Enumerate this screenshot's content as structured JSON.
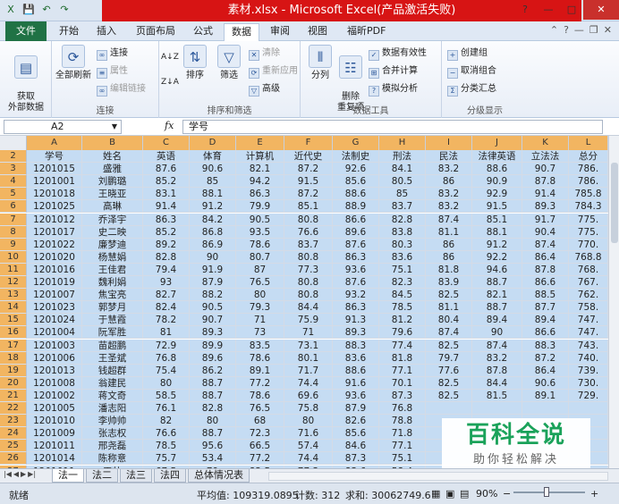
{
  "window": {
    "title": "素材.xlsx - Microsoft Excel(产品激活失败)",
    "help": "?",
    "minimize": "—",
    "maximize": "□",
    "close": "✕"
  },
  "qat": [
    "X",
    "💾",
    "↶",
    "↷"
  ],
  "tabs": {
    "file": "文件",
    "items": [
      "开始",
      "插入",
      "页面布局",
      "公式",
      "数据",
      "审阅",
      "视图",
      "福昕PDF"
    ],
    "active": "数据"
  },
  "ribbon": {
    "get_external": "获取\n外部数据",
    "refresh_all": "全部刷新",
    "connections": "连接",
    "properties": "属性",
    "edit_links": "编辑链接",
    "group_connections": "连接",
    "sort_az": "A↓Z",
    "sort_za": "Z↓A",
    "sort": "排序",
    "filter": "筛选",
    "clear": "清除",
    "reapply": "重新应用",
    "advanced": "高级",
    "group_sort": "排序和筛选",
    "split": "分列",
    "remove_dup": "删除\n重复项",
    "data_valid": "数据有效性",
    "consolidate": "合并计算",
    "whatif": "模拟分析",
    "group_datatools": "数据工具",
    "group_outline": "创建组",
    "ungroup": "取消组合",
    "subtotal": "分类汇总",
    "group_display": "分级显示"
  },
  "formula_bar": {
    "name_box": "A2",
    "fx": "fx",
    "content": "学号"
  },
  "columns": [
    "A",
    "B",
    "C",
    "D",
    "E",
    "F",
    "G",
    "H",
    "I",
    "J",
    "K",
    "L"
  ],
  "rows": [
    {
      "n": "2",
      "cells": [
        "学号",
        "姓名",
        "英语",
        "体育",
        "计算机",
        "近代史",
        "法制史",
        "刑法",
        "民法",
        "法律英语",
        "立法法",
        "总分"
      ]
    },
    {
      "n": "3",
      "cells": [
        "1201015",
        "盛雅",
        "87.6",
        "90.6",
        "82.1",
        "87.2",
        "92.6",
        "84.1",
        "83.2",
        "88.6",
        "90.7",
        "786."
      ]
    },
    {
      "n": "4",
      "cells": [
        "1201001",
        "刘鹏璐",
        "85.2",
        "85",
        "94.2",
        "91.5",
        "85.6",
        "80.5",
        "86",
        "90.9",
        "87.8",
        "786."
      ]
    },
    {
      "n": "5",
      "cells": [
        "1201018",
        "王晓亚",
        "83.1",
        "88.1",
        "86.3",
        "87.2",
        "88.6",
        "85",
        "83.2",
        "92.9",
        "91.4",
        "785.8"
      ]
    },
    {
      "n": "6",
      "cells": [
        "1201025",
        "高琳",
        "91.4",
        "91.2",
        "79.9",
        "85.1",
        "88.9",
        "83.7",
        "83.2",
        "91.5",
        "89.3",
        "784.3"
      ]
    },
    {
      "n": "7",
      "cells": [
        "1201012",
        "乔泽宇",
        "86.3",
        "84.2",
        "90.5",
        "80.8",
        "86.6",
        "82.8",
        "87.4",
        "85.1",
        "91.7",
        "775."
      ]
    },
    {
      "n": "8",
      "cells": [
        "1201017",
        "史二映",
        "85.2",
        "86.8",
        "93.5",
        "76.6",
        "89.6",
        "83.8",
        "81.1",
        "88.1",
        "90.4",
        "775."
      ]
    },
    {
      "n": "9",
      "cells": [
        "1201022",
        "廉梦迪",
        "89.2",
        "86.9",
        "78.6",
        "83.7",
        "87.6",
        "80.3",
        "86",
        "91.2",
        "87.4",
        "770."
      ]
    },
    {
      "n": "10",
      "cells": [
        "1201020",
        "杨慧娟",
        "82.8",
        "90",
        "80.7",
        "80.8",
        "86.3",
        "83.6",
        "86",
        "92.2",
        "86.4",
        "768.8"
      ]
    },
    {
      "n": "11",
      "cells": [
        "1201016",
        "王佳君",
        "79.4",
        "91.9",
        "87",
        "77.3",
        "93.6",
        "75.1",
        "81.8",
        "94.6",
        "87.8",
        "768."
      ]
    },
    {
      "n": "12",
      "cells": [
        "1201019",
        "魏利娟",
        "93",
        "87.9",
        "76.5",
        "80.8",
        "87.6",
        "82.3",
        "83.9",
        "88.7",
        "86.6",
        "767."
      ]
    },
    {
      "n": "13",
      "cells": [
        "1201007",
        "焦宝亮",
        "82.7",
        "88.2",
        "80",
        "80.8",
        "93.2",
        "84.5",
        "82.5",
        "82.1",
        "88.5",
        "762."
      ]
    },
    {
      "n": "14",
      "cells": [
        "1201023",
        "郭梦月",
        "82.4",
        "90.5",
        "79.3",
        "84.4",
        "86.3",
        "78.5",
        "81.1",
        "88.7",
        "87.7",
        "758."
      ]
    },
    {
      "n": "15",
      "cells": [
        "1201024",
        "于慧霞",
        "78.2",
        "90.7",
        "71",
        "75.9",
        "91.3",
        "81.2",
        "80.4",
        "89.4",
        "89.4",
        "747."
      ]
    },
    {
      "n": "16",
      "cells": [
        "1201004",
        "阮军胜",
        "81",
        "89.3",
        "73",
        "71",
        "89.3",
        "79.6",
        "87.4",
        "90",
        "86.6",
        "747."
      ]
    },
    {
      "n": "17",
      "cells": [
        "1201003",
        "苗超鹏",
        "72.9",
        "89.9",
        "83.5",
        "73.1",
        "88.3",
        "77.4",
        "82.5",
        "87.4",
        "88.3",
        "743."
      ]
    },
    {
      "n": "18",
      "cells": [
        "1201006",
        "王圣斌",
        "76.8",
        "89.6",
        "78.6",
        "80.1",
        "83.6",
        "81.8",
        "79.7",
        "83.2",
        "87.2",
        "740."
      ]
    },
    {
      "n": "19",
      "cells": [
        "1201013",
        "钱超群",
        "75.4",
        "86.2",
        "89.1",
        "71.7",
        "88.6",
        "77.1",
        "77.6",
        "87.8",
        "86.4",
        "739."
      ]
    },
    {
      "n": "20",
      "cells": [
        "1201008",
        "翁建民",
        "80",
        "88.7",
        "77.2",
        "74.4",
        "91.6",
        "70.1",
        "82.5",
        "84.4",
        "90.6",
        "730."
      ]
    },
    {
      "n": "21",
      "cells": [
        "1201002",
        "蒋文奇",
        "58.5",
        "88.7",
        "78.6",
        "69.6",
        "93.6",
        "87.3",
        "82.5",
        "81.5",
        "89.1",
        "729."
      ]
    },
    {
      "n": "22",
      "cells": [
        "1201005",
        "潘志阳",
        "76.1",
        "82.8",
        "76.5",
        "75.8",
        "87.9",
        "76.8",
        "",
        "",
        "",
        ""
      ]
    },
    {
      "n": "23",
      "cells": [
        "1201010",
        "李帅帅",
        "82",
        "80",
        "68",
        "80",
        "82.6",
        "78.8",
        "",
        "",
        "",
        ""
      ]
    },
    {
      "n": "24",
      "cells": [
        "1201009",
        "张志权",
        "76.6",
        "88.7",
        "72.3",
        "71.6",
        "85.6",
        "71.8",
        "",
        "",
        "",
        ""
      ]
    },
    {
      "n": "25",
      "cells": [
        "1201011",
        "邢尧磊",
        "78.5",
        "95.6",
        "66.5",
        "57.4",
        "84.6",
        "77.1",
        "",
        "",
        "",
        ""
      ]
    },
    {
      "n": "26",
      "cells": [
        "1201014",
        "陈称意",
        "75.7",
        "53.4",
        "77.2",
        "74.4",
        "87.3",
        "75.1",
        "",
        "",
        "",
        ""
      ]
    },
    {
      "n": "27",
      "cells": [
        "1201011",
        "王帅",
        "67.5",
        "79",
        "82.5",
        "77.3",
        "83.6",
        "58.4",
        "",
        "",
        "",
        ""
      ]
    }
  ],
  "sheets": [
    "法一",
    "法二",
    "法三",
    "法四",
    "总体情况表"
  ],
  "active_sheet": "法一",
  "status": {
    "ready": "就绪",
    "average": "平均值: 109319.0895",
    "count": "计数: 312",
    "sum": "求和: 30062749.6",
    "zoom": "90%",
    "minus": "−",
    "plus": "+"
  },
  "watermark": {
    "title": "百科全说",
    "subtitle": "助你轻松解决"
  }
}
